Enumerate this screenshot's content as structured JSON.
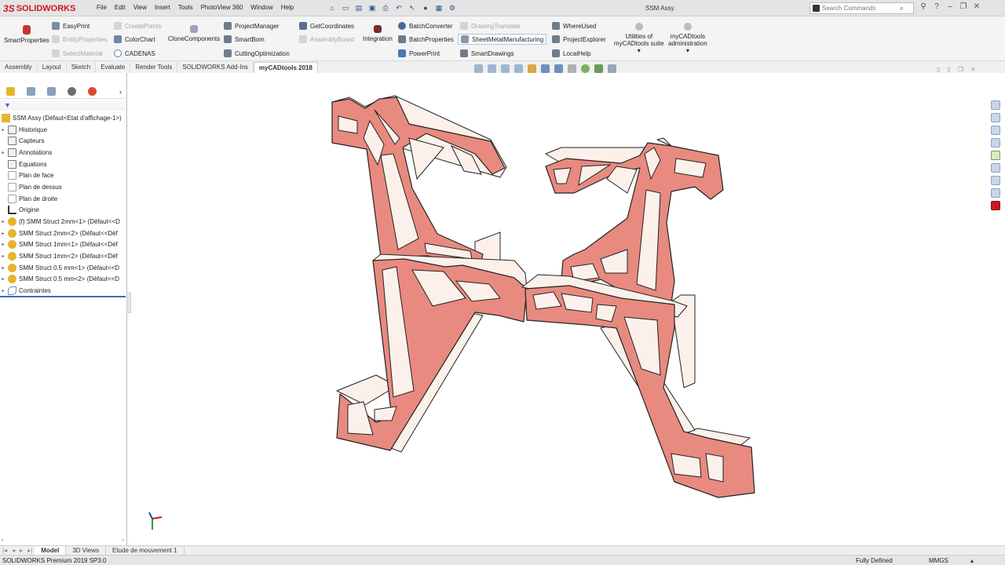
{
  "app": {
    "brand_ds": "3S",
    "brand_name": "SOLIDWORKS",
    "doc_title": "SSM Assy"
  },
  "menu": [
    "File",
    "Edit",
    "View",
    "Insert",
    "Tools",
    "PhotoView 360",
    "Window",
    "Help"
  ],
  "search": {
    "placeholder": "Search Commands"
  },
  "ribbon": {
    "smart_properties": "SmartProperties",
    "easy_print": "EasyPrint",
    "entity_properties": "EntityProperties",
    "select_material": "SelectMaterial",
    "create_points": "CreatePoints",
    "color_chart": "ColorChart",
    "cadenas": "CADENAS",
    "clone_components": "CloneComponents",
    "project_manager": "ProjectManager",
    "smart_bom": "SmartBom",
    "cutting_optimization": "CuttingOptimization",
    "get_coordinates": "GetCoordinates",
    "assembly_board": "AssemblyBoard",
    "integration": "Integration",
    "batch_converter": "BatchConverter",
    "batch_properties": "BatchProperties",
    "power_print": "PowerPrint",
    "drawing_translate": "DrawingTranslate",
    "sheet_metal_manufacturing": "SheetMetalManufacturing",
    "smart_drawings": "SmartDrawings",
    "where_used": "WhereUsed",
    "project_explorer": "ProjectExplorer",
    "local_help": "LocalHelp",
    "utilities_line1": "Utilities of",
    "utilities_line2": "myCADtools suite",
    "admin_line1": "myCADtools",
    "admin_line2": "administration"
  },
  "tabs": [
    "Assembly",
    "Layout",
    "Sketch",
    "Evaluate",
    "Render Tools",
    "SOLIDWORKS Add-Ins",
    "myCADtools 2018"
  ],
  "tree": {
    "root": "SSM Assy  (Défaut<Etat d'affichage-1>)",
    "items": [
      "Historique",
      "Capteurs",
      "Annotations",
      "Equations",
      "Plan de face",
      "Plan de dessus",
      "Plan de droite",
      "Origine",
      "(f) SMM Struct 2mm<1> (Défaut<<D",
      "SMM Struct 2mm<2> (Défaut<<Déf",
      "SMM Struct 1mm<1> (Défaut<<Déf",
      "SMM Struct 1mm<2> (Défaut<<Déf",
      "SMM Struct 0.5 mm<1> (Défaut<<D",
      "SMM Struct 0.5 mm<2> (Défaut<<D",
      "Contraintes"
    ]
  },
  "bottom_tabs": [
    "Model",
    "3D Views",
    "Etude de mouvement 1"
  ],
  "status": {
    "product": "SOLIDWORKS Premium 2019 SP3.0",
    "state": "Fully Defined",
    "units": "MMGS"
  },
  "colors": {
    "accent": "#d0161e",
    "face": "#e88a80",
    "face_edge": "#222222",
    "selection": "#3a6fb5"
  }
}
